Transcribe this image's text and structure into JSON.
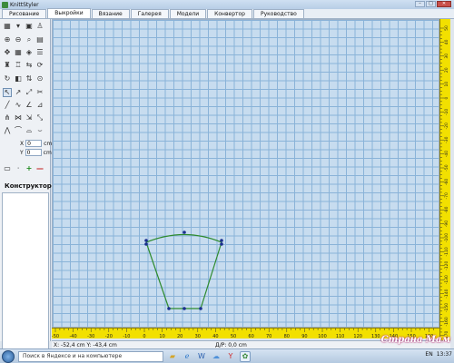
{
  "window": {
    "title": "KnittStyler",
    "controls": [
      "–",
      "□",
      "✕"
    ]
  },
  "tabs": [
    {
      "label": "Рисование",
      "active": false
    },
    {
      "label": "Выкройки",
      "active": true
    },
    {
      "label": "Вязание",
      "active": false
    },
    {
      "label": "Галерея",
      "active": false
    },
    {
      "label": "Модели",
      "active": false
    },
    {
      "label": "Конвертор",
      "active": false
    },
    {
      "label": "Руководство",
      "active": false
    }
  ],
  "sidebar": {
    "x_label": "X",
    "x_value": "0",
    "x_unit": "cm",
    "y_label": "Y",
    "y_value": "0",
    "y_unit": "cm",
    "add_symbol": "+",
    "remove_symbol": "—",
    "designer_label": "Конструктор"
  },
  "rulers": {
    "horizontal": [
      "-50",
      "-40",
      "-30",
      "-20",
      "-10",
      "0",
      "10",
      "20",
      "30",
      "40",
      "50",
      "60",
      "70",
      "80",
      "90",
      "100",
      "110",
      "120",
      "130",
      "140",
      "150",
      "160"
    ],
    "vertical": [
      "50",
      "40",
      "30",
      "20",
      "10",
      "0",
      "-10",
      "-20",
      "-30",
      "-40",
      "-50",
      "-60",
      "-70",
      "-80",
      "-90",
      "-100",
      "-110",
      "-120",
      "-130",
      "-140",
      "-150",
      "-160",
      "-170"
    ]
  },
  "status": {
    "coords": "X: -52,4 cm  Y: -43,4 cm",
    "dr": "Д/Р: 0,0 cm"
  },
  "taskbar": {
    "search_placeholder": "Поиск в Яндексе и на компьютере",
    "icons": [
      "folder-icon",
      "ie-icon",
      "word-icon",
      "cloud-icon",
      "yandex-icon",
      "knittstyler-icon"
    ],
    "tray_lang": "EN",
    "tray_time": "13:37"
  },
  "watermark": "Страна Мам",
  "colors": {
    "grid": "#c7dcef",
    "ruler": "#f2e000",
    "shape_line": "#2e8b2e",
    "point": "#1b2f8f"
  }
}
